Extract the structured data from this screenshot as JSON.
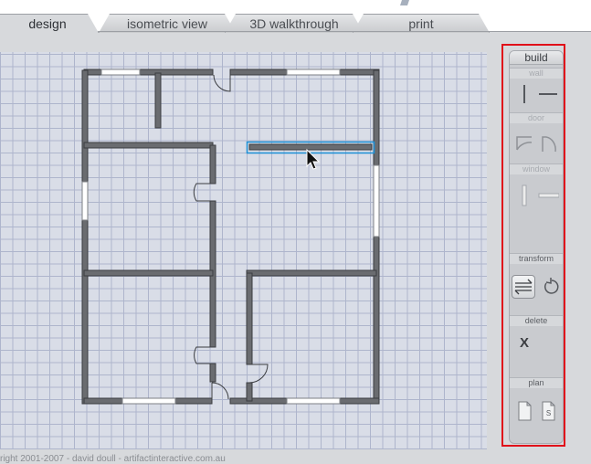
{
  "tabs": [
    {
      "label": "design",
      "active": true
    },
    {
      "label": "isometric view",
      "active": false
    },
    {
      "label": "3D walkthrough",
      "active": false
    },
    {
      "label": "print",
      "active": false
    }
  ],
  "tools": {
    "title": "build",
    "sections": {
      "wall": "wall",
      "door": "door",
      "window": "window",
      "transform": "transform",
      "delete": "delete",
      "plan": "plan"
    },
    "delete_glyph": "X",
    "save_glyph": "S"
  },
  "footer": "right 2001-2007 - david doull - artifactinteractive.com.au",
  "colors": {
    "selection": "#1b8fd6",
    "panel_highlight": "#e0101a",
    "grid": "#aeb5cc",
    "canvas": "#d9dde7"
  },
  "icons": [
    "vertical-wall-icon",
    "horizontal-wall-icon",
    "left-door-icon",
    "right-door-icon",
    "vertical-window-icon",
    "horizontal-window-icon",
    "flip-icon",
    "rotate-icon",
    "new-plan-icon",
    "save-plan-icon",
    "cursor-icon"
  ]
}
